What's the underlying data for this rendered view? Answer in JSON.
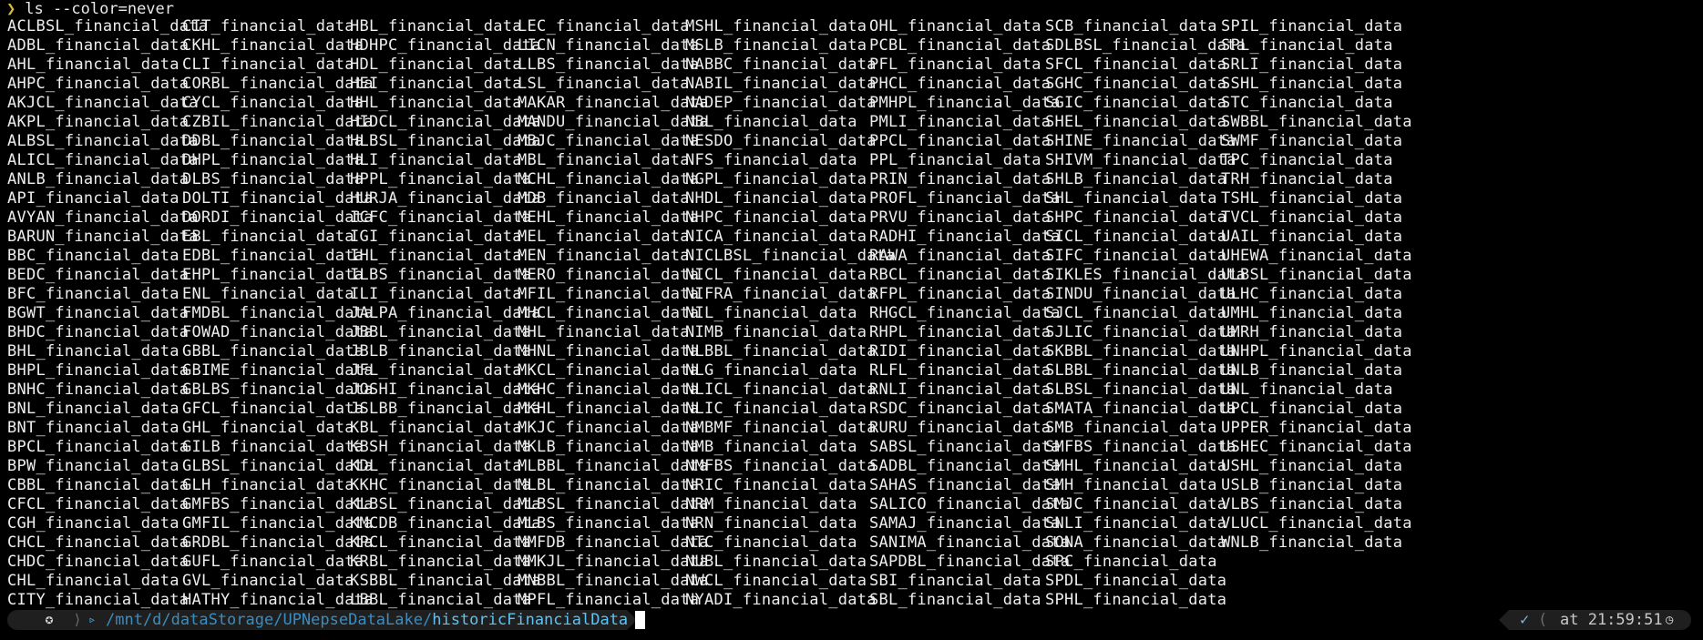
{
  "terminal": {
    "prompt_symbol": "❯",
    "command": "ls --color=never"
  },
  "columns": [
    [
      "ACLBSL_financial_data",
      "ADBL_financial_data",
      "AHL_financial_data",
      "AHPC_financial_data",
      "AKJCL_financial_data",
      "AKPL_financial_data",
      "ALBSL_financial_data",
      "ALICL_financial_data",
      "ANLB_financial_data",
      "API_financial_data",
      "AVYAN_financial_data",
      "BARUN_financial_data",
      "BBC_financial_data",
      "BEDC_financial_data",
      "BFC_financial_data",
      "BGWT_financial_data",
      "BHDC_financial_data",
      "BHL_financial_data",
      "BHPL_financial_data",
      "BNHC_financial_data",
      "BNL_financial_data",
      "BNT_financial_data",
      "BPCL_financial_data",
      "BPW_financial_data",
      "CBBL_financial_data",
      "CFCL_financial_data",
      "CGH_financial_data",
      "CHCL_financial_data",
      "CHDC_financial_data",
      "CHL_financial_data",
      "CITY_financial_data"
    ],
    [
      "CIT_financial_data",
      "CKHL_financial_data",
      "CLI_financial_data",
      "CORBL_financial_data",
      "CYCL_financial_data",
      "CZBIL_financial_data",
      "DDBL_financial_data",
      "DHPL_financial_data",
      "DLBS_financial_data",
      "DOLTI_financial_data",
      "DORDI_financial_data",
      "EBL_financial_data",
      "EDBL_financial_data",
      "EHPL_financial_data",
      "ENL_financial_data",
      "FMDBL_financial_data",
      "FOWAD_financial_data",
      "GBBL_financial_data",
      "GBIME_financial_data",
      "GBLBS_financial_data",
      "GFCL_financial_data",
      "GHL_financial_data",
      "GILB_financial_data",
      "GLBSL_financial_data",
      "GLH_financial_data",
      "GMFBS_financial_data",
      "GMFIL_financial_data",
      "GRDBL_financial_data",
      "GUFL_financial_data",
      "GVL_financial_data",
      "HATHY_financial_data"
    ],
    [
      "HBL_financial_data",
      "HDHPC_financial_data",
      "HDL_financial_data",
      "HEI_financial_data",
      "HHL_financial_data",
      "HIDCL_financial_data",
      "HLBSL_financial_data",
      "HLI_financial_data",
      "HPPL_financial_data",
      "HURJA_financial_data",
      "ICFC_financial_data",
      "IGI_financial_data",
      "IHL_financial_data",
      "ILBS_financial_data",
      "ILI_financial_data",
      "JALPA_financial_data",
      "JBBL_financial_data",
      "JBLB_financial_data",
      "JFL_financial_data",
      "JOSHI_financial_data",
      "JSLBB_financial_data",
      "KBL_financial_data",
      "KBSH_financial_data",
      "KDL_financial_data",
      "KKHC_financial_data",
      "KLBSL_financial_data",
      "KMCDB_financial_data",
      "KPCL_financial_data",
      "KRBL_financial_data",
      "KSBBL_financial_data",
      "LBBL_financial_data"
    ],
    [
      "LEC_financial_data",
      "LICN_financial_data",
      "LLBS_financial_data",
      "LSL_financial_data",
      "MAKAR_financial_data",
      "MANDU_financial_data",
      "MBJC_financial_data",
      "MBL_financial_data",
      "MCHL_financial_data",
      "MDB_financial_data",
      "MEHL_financial_data",
      "MEL_financial_data",
      "MEN_financial_data",
      "MERO_financial_data",
      "MFIL_financial_data",
      "MHCL_financial_data",
      "MHL_financial_data",
      "MHNL_financial_data",
      "MKCL_financial_data",
      "MKHC_financial_data",
      "MKHL_financial_data",
      "MKJC_financial_data",
      "MKLB_financial_data",
      "MLBBL_financial_data",
      "MLBL_financial_data",
      "MLBSL_financial_data",
      "MLBS_financial_data",
      "MMFDB_financial_data",
      "MMKJL_financial_data",
      "MNBBL_financial_data",
      "MPFL_financial_data"
    ],
    [
      "MSHL_financial_data",
      "MSLB_financial_data",
      "NABBC_financial_data",
      "NABIL_financial_data",
      "NADEP_financial_data",
      "NBL_financial_data",
      "NESDO_financial_data",
      "NFS_financial_data",
      "NGPL_financial_data",
      "NHDL_financial_data",
      "NHPC_financial_data",
      "NICA_financial_data",
      "NICLBSL_financial_data",
      "NICL_financial_data",
      "NIFRA_financial_data",
      "NIL_financial_data",
      "NIMB_financial_data",
      "NLBBL_financial_data",
      "NLG_financial_data",
      "NLICL_financial_data",
      "NLIC_financial_data",
      "NMBMF_financial_data",
      "NMB_financial_data",
      "NMFBS_financial_data",
      "NRIC_financial_data",
      "NRM_financial_data",
      "NRN_financial_data",
      "NTC_financial_data",
      "NUBL_financial_data",
      "NWCL_financial_data",
      "NYADI_financial_data"
    ],
    [
      "OHL_financial_data",
      "PCBL_financial_data",
      "PFL_financial_data",
      "PHCL_financial_data",
      "PMHPL_financial_data",
      "PMLI_financial_data",
      "PPCL_financial_data",
      "PPL_financial_data",
      "PRIN_financial_data",
      "PROFL_financial_data",
      "PRVU_financial_data",
      "RADHI_financial_data",
      "RAWA_financial_data",
      "RBCL_financial_data",
      "RFPL_financial_data",
      "RHGCL_financial_data",
      "RHPL_financial_data",
      "RIDI_financial_data",
      "RLFL_financial_data",
      "RNLI_financial_data",
      "RSDC_financial_data",
      "RURU_financial_data",
      "SABSL_financial_data",
      "SADBL_financial_data",
      "SAHAS_financial_data",
      "SALICO_financial_data",
      "SAMAJ_financial_data",
      "SANIMA_financial_data",
      "SAPDBL_financial_data",
      "SBI_financial_data",
      "SBL_financial_data"
    ],
    [
      "SCB_financial_data",
      "SDLBSL_financial_data",
      "SFCL_financial_data",
      "SGHC_financial_data",
      "SGIC_financial_data",
      "SHEL_financial_data",
      "SHINE_financial_data",
      "SHIVM_financial_data",
      "SHLB_financial_data",
      "SHL_financial_data",
      "SHPC_financial_data",
      "SICL_financial_data",
      "SIFC_financial_data",
      "SIKLES_financial_data",
      "SINDU_financial_data",
      "SJCL_financial_data",
      "SJLIC_financial_data",
      "SKBBL_financial_data",
      "SLBBL_financial_data",
      "SLBSL_financial_data",
      "SMATA_financial_data",
      "SMB_financial_data",
      "SMFBS_financial_data",
      "SMHL_financial_data",
      "SMH_financial_data",
      "SMJC_financial_data",
      "SNLI_financial_data",
      "SONA_financial_data",
      "SPC_financial_data",
      "SPDL_financial_data",
      "SPHL_financial_data"
    ],
    [
      "SPIL_financial_data",
      "SPL_financial_data",
      "SRLI_financial_data",
      "SSHL_financial_data",
      "STC_financial_data",
      "SWBBL_financial_data",
      "SWMF_financial_data",
      "TPC_financial_data",
      "TRH_financial_data",
      "TSHL_financial_data",
      "TVCL_financial_data",
      "UAIL_financial_data",
      "UHEWA_financial_data",
      "ULBSL_financial_data",
      "ULHC_financial_data",
      "UMHL_financial_data",
      "UMRH_financial_data",
      "UNHPL_financial_data",
      "UNLB_financial_data",
      "UNL_financial_data",
      "UPCL_financial_data",
      "UPPER_financial_data",
      "USHEC_financial_data",
      "USHL_financial_data",
      "USLB_financial_data",
      "VLBS_financial_data",
      "VLUCL_financial_data",
      "WNLB_financial_data"
    ]
  ],
  "prompt_bar": {
    "os_icon": "linux-icon",
    "folder_icon": "folder-icon",
    "path_prefix": "/mnt/d/dataStorage/UPNepseDataLake/",
    "path_last": "historicFinancialData",
    "status_icon": "check-icon",
    "time_text": "at 21:59:51",
    "clock_icon": "clock-icon"
  },
  "colors": {
    "background": "#000000",
    "text": "#ededed",
    "prompt_symbol": "#d6b940",
    "path": "#3b8dbf",
    "path_highlight": "#5cc3f2",
    "bar_segment": "#1f1f1f"
  }
}
